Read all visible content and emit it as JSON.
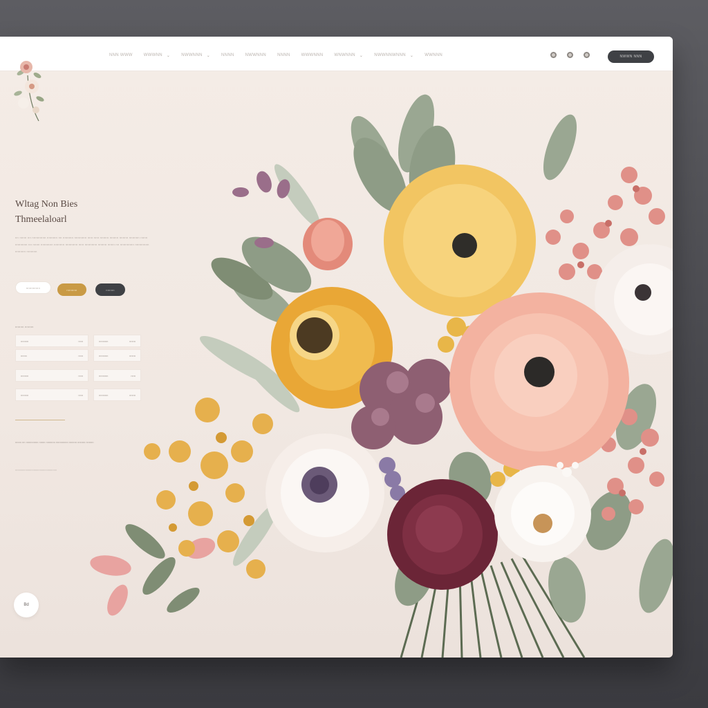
{
  "nav": {
    "items": [
      {
        "label": "NNN WWW",
        "has_dropdown": false
      },
      {
        "label": "WWWNN",
        "has_dropdown": true
      },
      {
        "label": "NWWNNN",
        "has_dropdown": true
      },
      {
        "label": "NNNN",
        "has_dropdown": false
      },
      {
        "label": "NWWNNN",
        "has_dropdown": false
      },
      {
        "label": "NNNN",
        "has_dropdown": false
      },
      {
        "label": "WWWNNN",
        "has_dropdown": false
      },
      {
        "label": "WNWNNN",
        "has_dropdown": true
      },
      {
        "label": "NWWNNWNNN",
        "has_dropdown": true
      },
      {
        "label": "WWNNN",
        "has_dropdown": false
      }
    ],
    "icons": [
      "globe-icon",
      "user-icon",
      "bag-icon"
    ],
    "cta_label": "NWWN NNN"
  },
  "hero": {
    "title_line1": "Wltag Non Bies",
    "title_line2": "Thmeelaloarl",
    "body": "nn nnnn nn nnnnnnnn nnnnnn nn nnnnnn nnnnnnn nnn nnn nnnnn nnnnn nnnnn nnnnnn nnnn nnnnnnn nn nnnn nnnnnnn nnnnnn nnnnnnn nnn nnnnnnn nnnnn nnnn nn nnnnnnnn nnnnnnnn nnnnnn nnnnnn",
    "buttons": [
      "nnnnnnnn",
      "nnnnnn",
      "nnnnn"
    ]
  },
  "details": {
    "section_label": "nnnnn nnnnn",
    "cards": [
      {
        "left": "nnnnn",
        "right": "nnn"
      },
      {
        "left": "nnnnnn",
        "right": "nnnn"
      },
      {
        "left": "nnnn",
        "right": "nnn"
      },
      {
        "left": "nnnnnn",
        "right": "nnnn"
      },
      {
        "left": "nnnnn",
        "right": "nnn"
      },
      {
        "left": "nnnnnn",
        "right": "nnn"
      },
      {
        "left": "nnnnn",
        "right": "nnn"
      },
      {
        "left": "nnnnnn",
        "right": "nnnn"
      }
    ],
    "small_text": "nnnn nn nnnnnnnn nnnn nnnnnn nnnnnnnn nnnnn nnnnn nnnnn",
    "tiny_text": "nnnnnnnnnnnnnnnnnnnnnnnnnnn"
  },
  "bottom_button_label": "Bd",
  "colors": {
    "accent": "#c99a45",
    "dark": "#3f4145",
    "background": "#f2e9e3",
    "title": "#5a4a44"
  }
}
